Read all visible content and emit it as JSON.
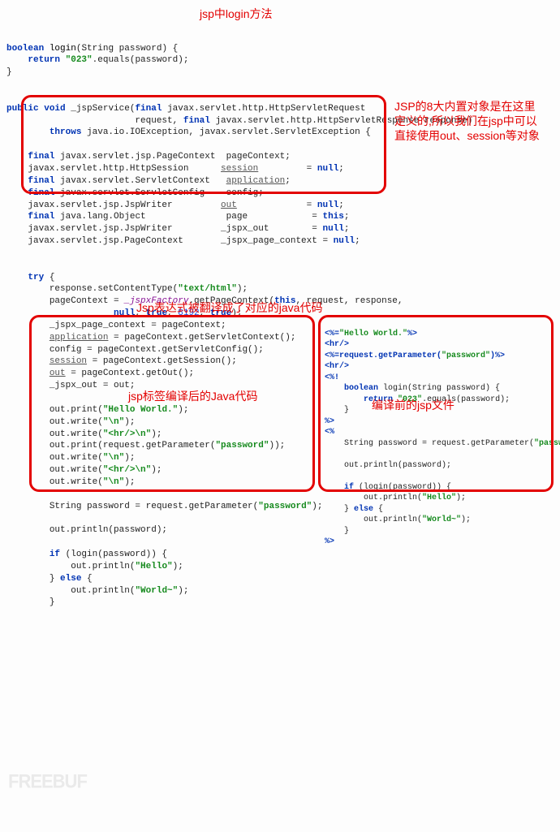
{
  "anno": {
    "a1": "jsp中login方法",
    "a2": "JSP的8大内置对象是在这里\n定义的,所以我们在jsp中可以\n直接使用out、session等对象",
    "a3": "Jsp表达式被翻译成了对应的java代码",
    "a4": "jsp标签编译后的Java代码",
    "a5": "编译前的jsp文件"
  },
  "kw": {
    "boolean": "boolean",
    "return": "return",
    "public": "public",
    "void": "void",
    "final": "final",
    "throws": "throws",
    "this": "this",
    "true": "true",
    "null": "null",
    "try": "try",
    "if": "if",
    "else": "else"
  },
  "sig": {
    "login": "login",
    "loginParam": "(String password) {",
    "ret023": "\"023\"",
    "eqPwd": ".equals(password);",
    "closeBrace": "}",
    "jspSvc": "_jspService(",
    "reqType": "javax.servlet.http.HttpServletRequest",
    "reqLine2a": "                        request, ",
    "respType": " javax.servlet.http.HttpServletResponse response)",
    "throwsLine": " java.io.IOException, javax.servlet.ServletException {"
  },
  "decl": {
    "l1a": " javax.servlet.jsp.PageContext  pageContext;",
    "l2a": "javax.servlet.http.HttpSession      ",
    "l2b": "session",
    "l2c": "         = ",
    "l3a": " javax.servlet.ServletContext   ",
    "l3b": "application",
    "l3c": ";",
    "l4a": " javax.servlet.ServletConfig    config;",
    "l5a": "javax.servlet.jsp.JspWriter         ",
    "l5b": "out",
    "l5c": "             = ",
    "l6a": " java.lang.Object               page            = ",
    "l7a": "javax.servlet.jsp.JspWriter         _jspx_out        = ",
    "l8a": "javax.servlet.jsp.PageContext       _jspx_page_context = "
  },
  "tryb": {
    "l1": "response.setContentType(",
    "l1s": "\"text/html\"",
    "l1e": ");",
    "l2a": "pageContext = ",
    "l2f": "_jspxFactory",
    "l2b": ".getPageContext(",
    "l2e": ", request, response,",
    "l3a": "            ",
    "l3b": ", ",
    "l3n": "8192",
    "l3e": ");",
    "l4": "_jspx_page_context = pageContext;",
    "l5a": "application",
    "l5b": " = pageContext.getServletContext();",
    "l6": "config = pageContext.getServletConfig();",
    "l7a": "session",
    "l7b": " = pageContext.getSession();",
    "l8a": "out",
    "l8b": " = pageContext.getOut();",
    "l9": "_jspx_out = out;"
  },
  "left": {
    "l1a": "out.print(",
    "l1s": "\"Hello World.\"",
    "l1e": ");",
    "l2a": "out.write(",
    "l2s": "\"\\n\"",
    "l2e": ");",
    "l3a": "out.write(",
    "l3s": "\"<hr/>\\n\"",
    "l3e": ");",
    "l4a": "out.print(request.getParameter(",
    "l4s": "\"password\"",
    "l4e": "));",
    "l5a": "out.write(",
    "l5s": "\"\\n\"",
    "l5e": ");",
    "l6a": "out.write(",
    "l6s": "\"<hr/>\\n\"",
    "l6e": ");",
    "l7a": "out.write(",
    "l7s": "\"\\n\"",
    "l7e": ");",
    "l8a": "String password = request.getParameter(",
    "l8s": "\"password\"",
    "l8e": ");",
    "l9": "out.println(password);",
    "l10a": " (login(password)) {",
    "l11a": "    out.println(",
    "l11s": "\"Hello\"",
    "l11e": ");",
    "l12": "} ",
    "l12b": " {",
    "l13a": "    out.println(",
    "l13s": "\"World~\"",
    "l13e": ");",
    "l14": "}"
  },
  "right": {
    "l1a": "<%=",
    "l1s": "\"Hello World.\"",
    "l1e": "%>",
    "l2": "<hr/>",
    "l3a": "<%=request.getParameter(",
    "l3s": "\"password\"",
    "l3e": ")%>",
    "l4": "<hr/>",
    "l5": "<%!",
    "l6a": "    ",
    "l6b": " login(String password) {",
    "l7a": "        ",
    "l7s": "\"023\"",
    "l7e": ".equals(password);",
    "l8": "    }",
    "l9": "%>",
    "l10": "<%",
    "l11a": "    String password = request.getParameter(",
    "l11s": "\"password\"",
    "l11e": ");",
    "l12": "    out.println(password);",
    "l13a": "    ",
    "l13b": " (login(password)) {",
    "l14a": "        out.println(",
    "l14s": "\"Hello\"",
    "l14e": ");",
    "l15a": "    } ",
    "l15b": " {",
    "l16a": "        out.println(",
    "l16s": "\"World~\"",
    "l16e": ");",
    "l17": "    }",
    "l18": "%>"
  },
  "watermark": "FREEBUF"
}
